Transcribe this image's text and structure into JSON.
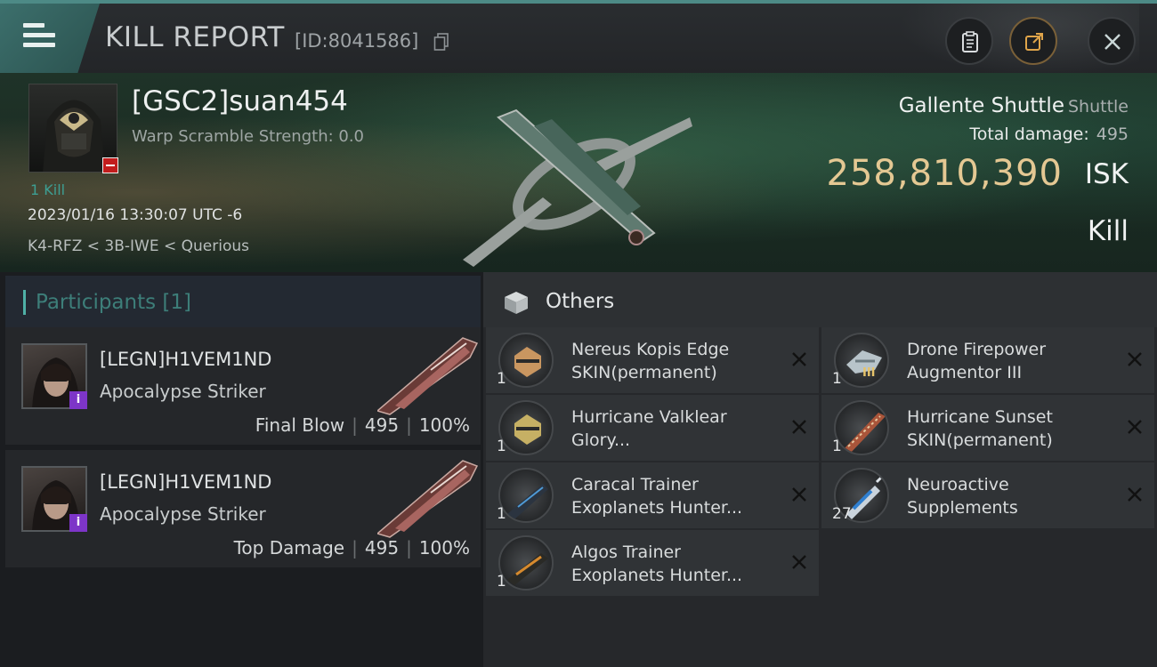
{
  "header": {
    "title": "KILL REPORT",
    "report_id": "[ID:8041586]"
  },
  "victim": {
    "name": "[GSC2]suan454",
    "warp_scramble": "Warp Scramble Strength: 0.0",
    "kills": "1 Kill",
    "datetime": "2023/01/16 13:30:07 UTC -6",
    "location": "K4-RFZ < 3B-IWE < Querious",
    "ship_name": "Gallente Shuttle",
    "ship_class": "Shuttle",
    "total_damage_label": "Total damage:",
    "total_damage": "495",
    "isk_value": "258,810,390",
    "isk_unit": "ISK",
    "result": "Kill"
  },
  "participants": {
    "title": "Participants [1]",
    "rows": [
      {
        "name": "[LEGN]H1VEM1ND",
        "ship": "Apocalypse Striker",
        "role": "Final Blow",
        "damage": "495",
        "percent": "100%"
      },
      {
        "name": "[LEGN]H1VEM1ND",
        "ship": "Apocalypse Striker",
        "role": "Top Damage",
        "damage": "495",
        "percent": "100%"
      }
    ]
  },
  "others": {
    "title": "Others",
    "items": [
      {
        "line1": "Nereus Kopis Edge",
        "line2": "SKIN(permanent)",
        "qty": "1",
        "icon": "skin-icon"
      },
      {
        "line1": "Drone Firepower",
        "line2": "Augmentor III",
        "qty": "1",
        "icon": "drone-augmentor-icon",
        "tier": "III"
      },
      {
        "line1": "Hurricane Valklear",
        "line2": "Glory...",
        "qty": "1",
        "icon": "skin-icon"
      },
      {
        "line1": "Hurricane Sunset",
        "line2": "SKIN(permanent)",
        "qty": "1",
        "icon": "ship-skin-icon"
      },
      {
        "line1": "Caracal Trainer",
        "line2": "Exoplanets Hunter...",
        "qty": "1",
        "icon": "ship-skin-icon"
      },
      {
        "line1": "Neuroactive",
        "line2": "Supplements",
        "qty": "27",
        "icon": "syringe-icon"
      },
      {
        "line1": "Algos Trainer",
        "line2": "Exoplanets Hunter...",
        "qty": "1",
        "icon": "ship-skin-icon"
      }
    ]
  },
  "colors": {
    "accent_teal": "#4d8a86",
    "isk_gold": "#e4c893",
    "status_red": "#c21d1d",
    "corp_purple": "#7d35c8"
  }
}
